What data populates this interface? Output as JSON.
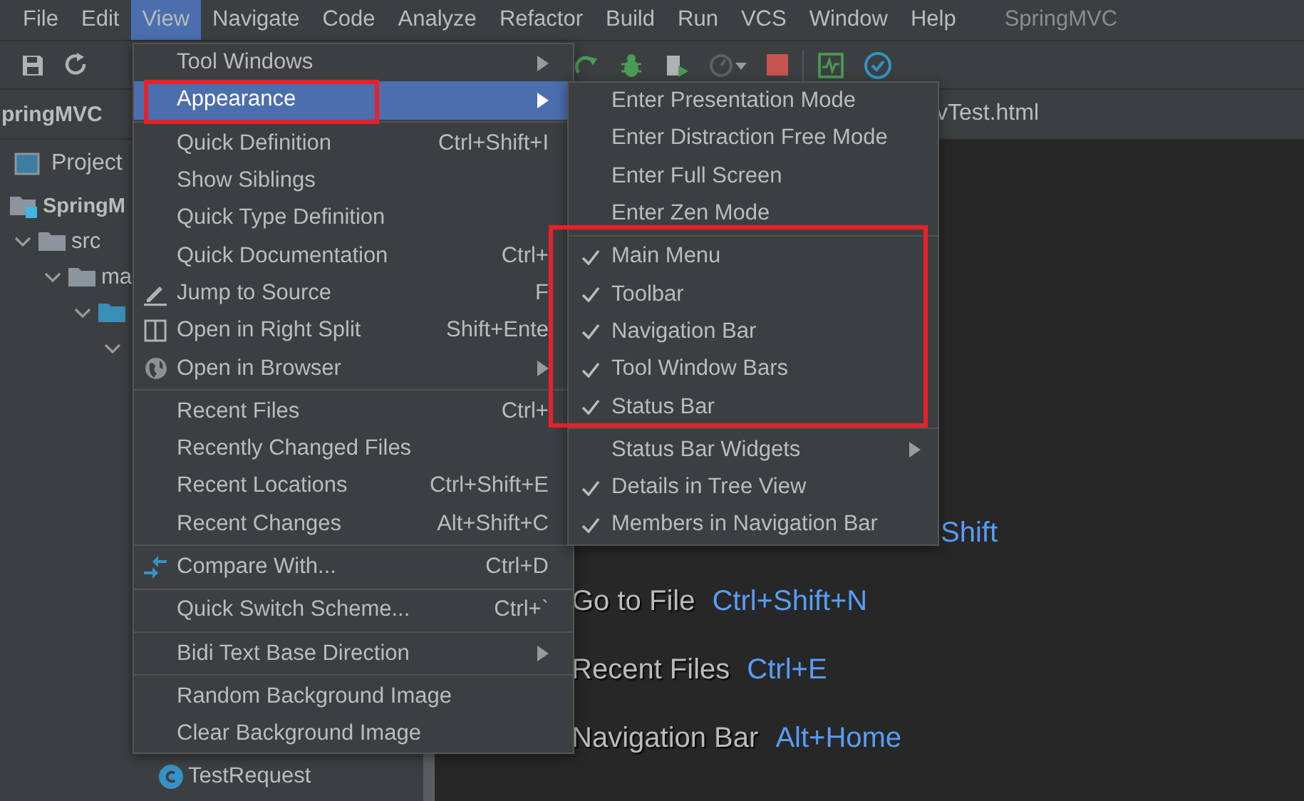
{
  "menu_bar": {
    "items": [
      {
        "label": "File",
        "selected": false
      },
      {
        "label": "Edit",
        "selected": false
      },
      {
        "label": "View",
        "selected": true
      },
      {
        "label": "Navigate",
        "selected": false
      },
      {
        "label": "Code",
        "selected": false
      },
      {
        "label": "Analyze",
        "selected": false
      },
      {
        "label": "Refactor",
        "selected": false
      },
      {
        "label": "Build",
        "selected": false
      },
      {
        "label": "Run",
        "selected": false
      },
      {
        "label": "VCS",
        "selected": false
      },
      {
        "label": "Window",
        "selected": false
      },
      {
        "label": "Help",
        "selected": false
      }
    ],
    "title": "SpringMVC"
  },
  "navigation_bar": {
    "crumb": "pringMVC"
  },
  "editor_tab": {
    "label": "vTest.html"
  },
  "project_panel": {
    "title": "Project",
    "tree": [
      {
        "name": "SpringM",
        "kind": "module",
        "children": [
          {
            "name": "src",
            "kind": "folder",
            "children": [
              {
                "name": "ma",
                "kind": "folder",
                "children": [
                  {
                    "kind": "source-folder",
                    "children": [
                      {
                        "children": [
                          {
                            "name": "TestRequest",
                            "kind": "class"
                          }
                        ]
                      }
                    ]
                  }
                ]
              }
            ]
          }
        ]
      }
    ]
  },
  "editor_hints": [
    {
      "keys": "Shift"
    },
    {
      "action": "Go to File",
      "keys": "Ctrl+Shift+N"
    },
    {
      "action": "Recent Files",
      "keys": "Ctrl+E"
    },
    {
      "action": "Navigation Bar",
      "keys": "Alt+Home"
    }
  ],
  "view_menu": {
    "sections": [
      {
        "items": [
          {
            "label": "Tool Windows",
            "submenu": true,
            "selected": false
          },
          {
            "label": "Appearance",
            "submenu": true,
            "selected": true,
            "annotated": true
          }
        ]
      },
      {
        "items": [
          {
            "label": "Quick Definition",
            "shortcut": "Ctrl+Shift+I",
            "selected": false
          },
          {
            "label": "Show Siblings",
            "selected": false
          },
          {
            "label": "Quick Type Definition",
            "selected": false
          },
          {
            "label": "Quick Documentation",
            "shortcut": "Ctrl+",
            "selected": false
          },
          {
            "label": "Jump to Source",
            "shortcut": "F",
            "selected": false
          },
          {
            "label": "Open in Right Split",
            "shortcut": "Shift+Ente",
            "selected": false
          },
          {
            "label": "Open in Browser",
            "submenu": true,
            "selected": false
          }
        ]
      },
      {
        "items": [
          {
            "label": "Recent Files",
            "shortcut": "Ctrl+",
            "selected": false
          },
          {
            "label": "Recently Changed Files",
            "selected": false
          },
          {
            "label": "Recent Locations",
            "shortcut": "Ctrl+Shift+E",
            "selected": false
          },
          {
            "label": "Recent Changes",
            "shortcut": "Alt+Shift+C",
            "selected": false
          }
        ]
      },
      {
        "items": [
          {
            "label": "Compare With...",
            "shortcut": "Ctrl+D",
            "selected": false
          }
        ]
      },
      {
        "items": [
          {
            "label": "Quick Switch Scheme...",
            "shortcut": "Ctrl+`",
            "selected": false
          }
        ]
      },
      {
        "items": [
          {
            "label": "Bidi Text Base Direction",
            "submenu": true,
            "selected": false
          }
        ]
      },
      {
        "items": [
          {
            "label": "Random Background Image",
            "selected": false
          },
          {
            "label": "Clear Background Image",
            "selected": false
          }
        ]
      }
    ]
  },
  "appearance_submenu": {
    "sections": [
      {
        "items": [
          {
            "label": "Enter Presentation Mode",
            "checked": false
          },
          {
            "label": "Enter Distraction Free Mode",
            "checked": false
          },
          {
            "label": "Enter Full Screen",
            "checked": false
          },
          {
            "label": "Enter Zen Mode",
            "checked": false
          }
        ]
      },
      {
        "annotated": true,
        "items": [
          {
            "label": "Main Menu",
            "checked": true
          },
          {
            "label": "Toolbar",
            "checked": true
          },
          {
            "label": "Navigation Bar",
            "checked": true
          },
          {
            "label": "Tool Window Bars",
            "checked": true
          },
          {
            "label": "Status Bar",
            "checked": true
          }
        ]
      },
      {
        "items": [
          {
            "label": "Status Bar Widgets",
            "checked": false,
            "submenu": true
          },
          {
            "label": "Details in Tree View",
            "checked": true
          },
          {
            "label": "Members in Navigation Bar",
            "checked": true
          }
        ]
      }
    ]
  }
}
